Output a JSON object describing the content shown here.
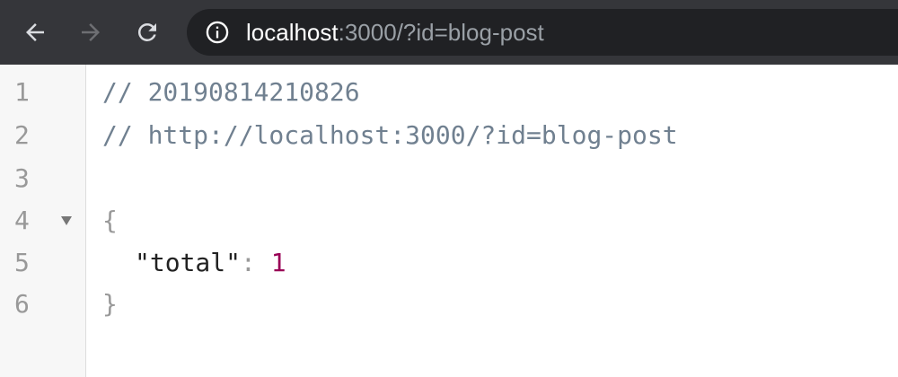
{
  "browser": {
    "back_icon": "arrow-left-icon",
    "forward_icon": "arrow-right-icon",
    "reload_icon": "reload-icon",
    "info_icon": "info-circle-icon",
    "url_host": "localhost",
    "url_rest": ":3000/?id=blog-post",
    "forward_enabled": false
  },
  "editor": {
    "line_numbers": [
      "1",
      "2",
      "3",
      "4",
      "5",
      "6"
    ],
    "fold_icon": "fold-triangle-icon",
    "lines": {
      "comment1": "// 20190814210826",
      "comment2": "// http://localhost:3000/?id=blog-post",
      "open_brace": "{",
      "key": "\"total\"",
      "colon": ": ",
      "value": "1",
      "close_brace": "}"
    }
  },
  "colors": {
    "toolbar": "#35363a",
    "omnibox": "#202124",
    "comment": "#708090",
    "number": "#990055"
  }
}
